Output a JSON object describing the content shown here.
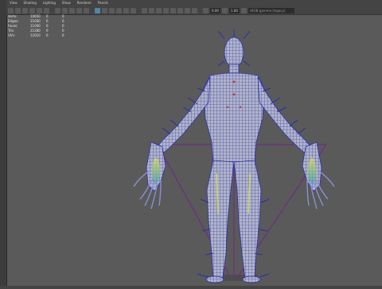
{
  "menu": [
    "View",
    "Shading",
    "Lighting",
    "Show",
    "Renderer",
    "Panels"
  ],
  "toolbar": {
    "field_a": "0.00",
    "field_b": "1.00",
    "color_mgmt": "sRGB gamma (legacy)"
  },
  "hud": {
    "rows": [
      {
        "label": "Verts:",
        "v1": "10650",
        "v2": "0",
        "v3": "0"
      },
      {
        "label": "Edges:",
        "v1": "21600",
        "v2": "0",
        "v3": "0"
      },
      {
        "label": "Faces:",
        "v1": "11000",
        "v2": "0",
        "v3": "0"
      },
      {
        "label": "Tris:",
        "v1": "21280",
        "v2": "0",
        "v3": "0"
      },
      {
        "label": "UVs:",
        "v1": "12010",
        "v2": "0",
        "v3": "0"
      }
    ]
  },
  "colors": {
    "viewport_bg": "#5a5a5a",
    "wire": "#2b2fa6",
    "mesh": "#b0b4c8",
    "skeleton": "#6e2e82",
    "toolbar_active": "#5285a6"
  }
}
